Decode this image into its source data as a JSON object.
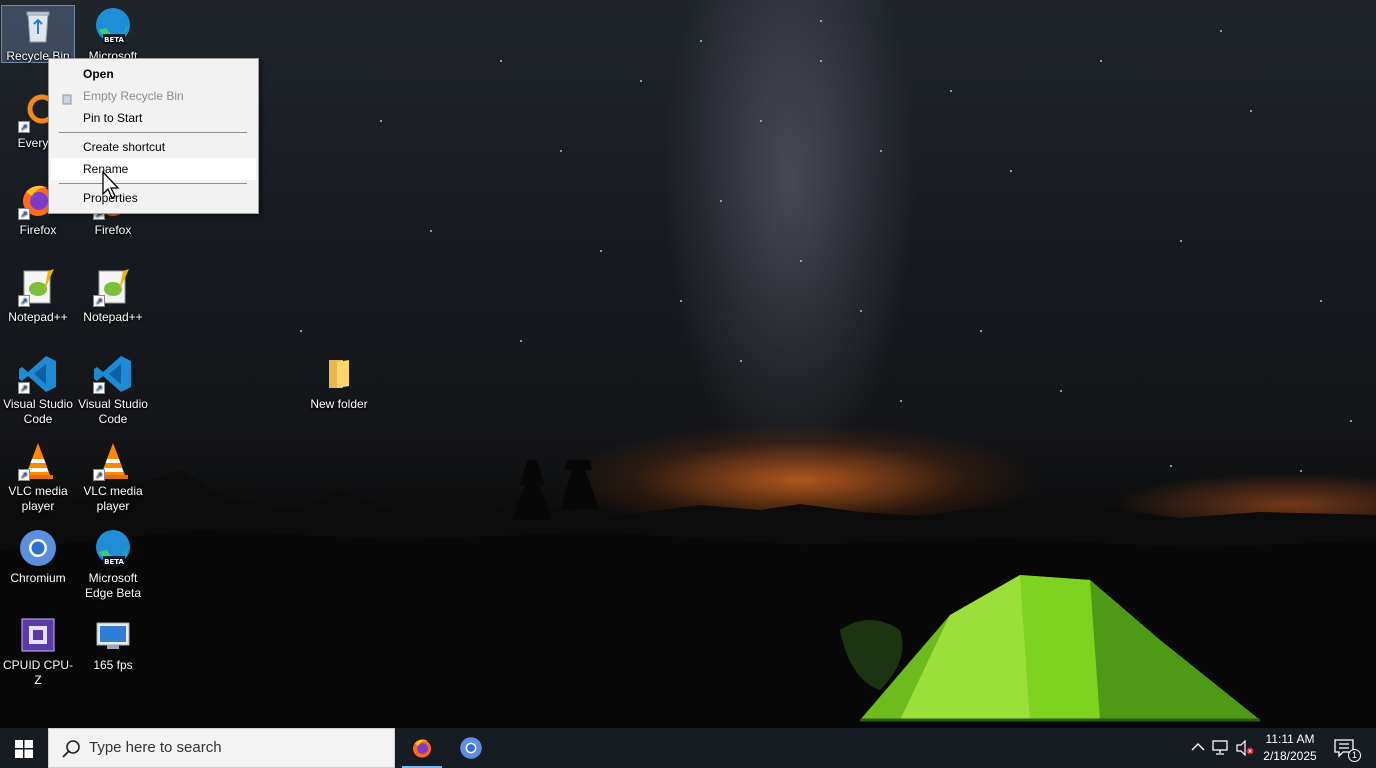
{
  "desktop": {
    "icons": [
      {
        "id": "recycle-bin",
        "label": "Recycle Bin"
      },
      {
        "id": "edge-beta-1",
        "label": "Microsoft"
      },
      {
        "id": "everything",
        "label": "Everyth"
      },
      {
        "id": "firefox-1",
        "label": "Firefox"
      },
      {
        "id": "firefox-2",
        "label": "Firefox"
      },
      {
        "id": "notepadpp-1",
        "label": "Notepad++"
      },
      {
        "id": "notepadpp-2",
        "label": "Notepad++"
      },
      {
        "id": "vscode-1",
        "label": "Visual Studio Code"
      },
      {
        "id": "vscode-2",
        "label": "Visual Studio Code"
      },
      {
        "id": "vlc-1",
        "label": "VLC media player"
      },
      {
        "id": "vlc-2",
        "label": "VLC media player"
      },
      {
        "id": "chromium",
        "label": "Chromium"
      },
      {
        "id": "edge-beta-2",
        "label": "Microsoft Edge Beta"
      },
      {
        "id": "cpuz",
        "label": "CPUID CPU-Z"
      },
      {
        "id": "fps",
        "label": "165 fps"
      },
      {
        "id": "new-folder",
        "label": "New folder"
      }
    ]
  },
  "context_menu": {
    "items": [
      {
        "label": "Open",
        "bold": true,
        "disabled": false
      },
      {
        "label": "Empty Recycle Bin",
        "bold": false,
        "disabled": true
      },
      {
        "label": "Pin to Start",
        "bold": false,
        "disabled": false
      },
      {
        "label": "Create shortcut",
        "bold": false,
        "disabled": false
      },
      {
        "label": "Rename",
        "bold": false,
        "disabled": false,
        "hover": true
      },
      {
        "label": "Properties",
        "bold": false,
        "disabled": false
      }
    ]
  },
  "taskbar": {
    "search_placeholder": "Type here to search",
    "pinned": [
      "firefox-icon",
      "chromium-icon"
    ],
    "clock": {
      "time": "11:11 AM",
      "date": "2/18/2025"
    },
    "notification_count": "1"
  },
  "colors": {
    "taskbar_bg": "#171c22",
    "menu_bg": "#f2f2f2",
    "accent": "#76b9ed",
    "tent_green": "#7ed321"
  }
}
